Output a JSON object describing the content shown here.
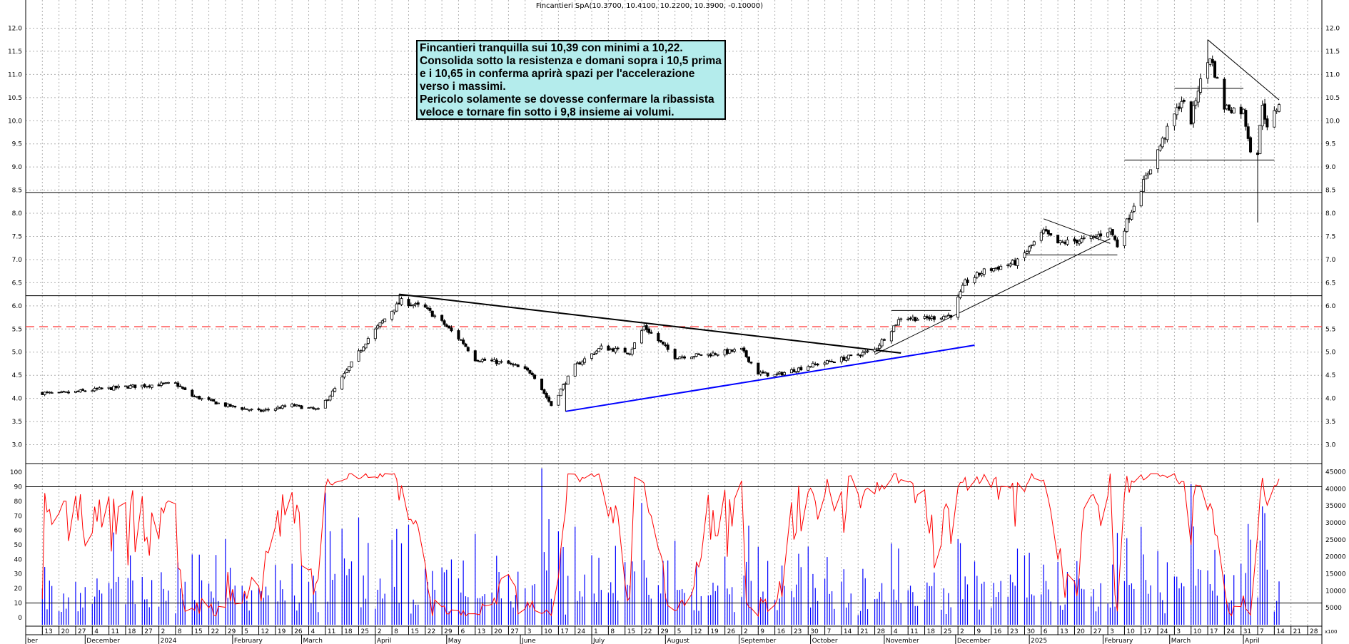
{
  "chart_data": [
    {
      "type": "candlestick",
      "title": "Fincantieri SpA(10.3700, 10.4100, 10.2200, 10.3900, -0.10000)",
      "ylim": [
        2.7,
        12.3
      ],
      "y_ticks": [
        "12.0",
        "11.5",
        "11.0",
        "10.5",
        "10.0",
        "9.5",
        "9.0",
        "8.5",
        "8.0",
        "7.5",
        "7.0",
        "6.5",
        "6.0",
        "5.5",
        "5.0",
        "4.5",
        "4.0",
        "3.5",
        "3.0"
      ],
      "annotation": "Fincantieri tranquilla sui 10,39 con minimi a 10,22.\nConsolida sotto la resistenza e domani sopra i 10,5 prima e i 10,65 in conferma aprirà spazi per l'accelerazione verso i massimi.\nPericolo solamente se dovesse confermare la ribassista veloce e tornare fin sotto i 9,8 insieme ai volumi.",
      "horizontal_levels": [
        8.45,
        6.22,
        5.55
      ],
      "dashed_level": 5.55,
      "anchors": [
        {
          "date": "2023-11-13",
          "close": 4.12
        },
        {
          "date": "2023-11-20",
          "close": 4.1
        },
        {
          "date": "2023-12-04",
          "close": 4.18
        },
        {
          "date": "2023-12-18",
          "close": 4.25
        },
        {
          "date": "2024-01-01",
          "close": 4.3
        },
        {
          "date": "2024-01-08",
          "close": 4.32
        },
        {
          "date": "2024-01-15",
          "close": 4.05
        },
        {
          "date": "2024-01-29",
          "close": 3.85
        },
        {
          "date": "2024-02-12",
          "close": 3.72
        },
        {
          "date": "2024-02-26",
          "close": 3.85
        },
        {
          "date": "2024-03-08",
          "close": 3.75
        },
        {
          "date": "2024-03-15",
          "close": 4.2
        },
        {
          "date": "2024-03-29",
          "close": 5.3
        },
        {
          "date": "2024-04-08",
          "close": 5.9
        },
        {
          "date": "2024-04-12",
          "close": 6.1
        },
        {
          "date": "2024-04-22",
          "close": 5.95
        },
        {
          "date": "2024-04-30",
          "close": 5.6
        },
        {
          "date": "2024-05-08",
          "close": 5.2
        },
        {
          "date": "2024-05-13",
          "close": 4.85
        },
        {
          "date": "2024-05-27",
          "close": 4.75
        },
        {
          "date": "2024-06-06",
          "close": 4.55
        },
        {
          "date": "2024-06-14",
          "close": 3.85
        },
        {
          "date": "2024-06-24",
          "close": 4.7
        },
        {
          "date": "2024-07-05",
          "close": 5.1
        },
        {
          "date": "2024-07-17",
          "close": 5.0
        },
        {
          "date": "2024-07-23",
          "close": 5.55
        },
        {
          "date": "2024-08-05",
          "close": 4.9
        },
        {
          "date": "2024-08-19",
          "close": 4.95
        },
        {
          "date": "2024-09-02",
          "close": 5.05
        },
        {
          "date": "2024-09-09",
          "close": 4.55
        },
        {
          "date": "2024-09-16",
          "close": 4.5
        },
        {
          "date": "2024-09-30",
          "close": 4.7
        },
        {
          "date": "2024-10-14",
          "close": 4.85
        },
        {
          "date": "2024-10-28",
          "close": 5.05
        },
        {
          "date": "2024-11-08",
          "close": 5.75
        },
        {
          "date": "2024-11-18",
          "close": 5.72
        },
        {
          "date": "2024-11-29",
          "close": 5.8
        },
        {
          "date": "2024-12-05",
          "close": 6.5
        },
        {
          "date": "2024-12-13",
          "close": 6.75
        },
        {
          "date": "2024-12-27",
          "close": 6.95
        },
        {
          "date": "2025-01-07",
          "close": 7.6
        },
        {
          "date": "2025-01-13",
          "close": 7.35
        },
        {
          "date": "2025-01-27",
          "close": 7.45
        },
        {
          "date": "2025-02-04",
          "close": 7.65
        },
        {
          "date": "2025-02-07",
          "close": 7.3
        },
        {
          "date": "2025-02-14",
          "close": 8.2
        },
        {
          "date": "2025-02-24",
          "close": 9.35
        },
        {
          "date": "2025-03-06",
          "close": 10.45
        },
        {
          "date": "2025-03-10",
          "close": 10.0
        },
        {
          "date": "2025-03-13",
          "close": 10.7
        },
        {
          "date": "2025-03-18",
          "close": 11.4
        },
        {
          "date": "2025-03-24",
          "close": 10.3
        },
        {
          "date": "2025-04-01",
          "close": 10.2
        },
        {
          "date": "2025-04-04",
          "close": 9.4
        },
        {
          "date": "2025-04-07",
          "close": 9.3
        },
        {
          "date": "2025-04-09",
          "close": 10.4
        },
        {
          "date": "2025-04-11",
          "close": 9.8
        },
        {
          "date": "2025-04-16",
          "close": 10.39
        }
      ],
      "extremes": [
        {
          "date": "2024-04-11",
          "high": 6.25
        },
        {
          "date": "2024-06-20",
          "low": 3.72
        },
        {
          "date": "2025-03-17",
          "high": 11.75
        },
        {
          "date": "2025-04-07",
          "low": 7.8
        }
      ],
      "trendlines": [
        {
          "color": "#000000",
          "width": 2,
          "from": {
            "date": "2024-04-11",
            "price": 6.25
          },
          "to": {
            "date": "2024-11-08",
            "price": 4.98
          }
        },
        {
          "color": "#0000ff",
          "width": 2,
          "from": {
            "date": "2024-06-20",
            "price": 3.72
          },
          "to": {
            "date": "2024-12-09",
            "price": 5.15
          }
        },
        {
          "color": "#000000",
          "width": 1,
          "from": {
            "date": "2024-10-28",
            "price": 4.95
          },
          "to": {
            "date": "2025-02-04",
            "price": 7.45
          }
        },
        {
          "color": "#000000",
          "width": 1,
          "from": {
            "date": "2025-01-07",
            "price": 7.88
          },
          "to": {
            "date": "2025-02-04",
            "price": 7.35
          }
        },
        {
          "color": "#000000",
          "width": 1,
          "from": {
            "date": "2025-03-17",
            "price": 11.75
          },
          "to": {
            "date": "2025-04-16",
            "price": 10.45
          }
        },
        {
          "color": "#000000",
          "width": 1,
          "from": {
            "date": "2024-11-04",
            "price": 5.9
          },
          "to": {
            "date": "2024-11-29",
            "price": 5.9
          }
        },
        {
          "color": "#000000",
          "width": 1,
          "from": {
            "date": "2024-12-30",
            "price": 7.1
          },
          "to": {
            "date": "2025-02-07",
            "price": 7.1
          }
        },
        {
          "color": "#000000",
          "width": 1,
          "from": {
            "date": "2025-02-10",
            "price": 9.15
          },
          "to": {
            "date": "2025-04-14",
            "price": 9.15
          }
        },
        {
          "color": "#000000",
          "width": 1,
          "from": {
            "date": "2025-03-03",
            "price": 10.7
          },
          "to": {
            "date": "2025-04-01",
            "price": 10.7
          }
        }
      ]
    },
    {
      "type": "line+bar",
      "left_ylim": [
        -5,
        105
      ],
      "left_ticks": [
        "100",
        "90",
        "80",
        "70",
        "60",
        "50",
        "40",
        "30",
        "20",
        "10",
        "0"
      ],
      "right_ylim": [
        0,
        47000
      ],
      "right_ticks": [
        "45000",
        "40000",
        "35000",
        "30000",
        "25000",
        "20000",
        "15000",
        "10000",
        "5000"
      ],
      "levels": [
        90,
        10
      ],
      "oscillator_color": "#ff0000",
      "volume_color": "#0000ff",
      "x_days": [
        "13",
        "20",
        "27",
        "4",
        "11",
        "18",
        "27",
        "2",
        "8",
        "15",
        "22",
        "29",
        "5",
        "12",
        "19",
        "26",
        "4",
        "11",
        "18",
        "25",
        "2",
        "8",
        "15",
        "22",
        "29",
        "6",
        "13",
        "20",
        "27",
        "3",
        "10",
        "17",
        "24",
        "1",
        "8",
        "15",
        "22",
        "29",
        "5",
        "12",
        "19",
        "26",
        "2",
        "9",
        "16",
        "23",
        "30",
        "7",
        "14",
        "21",
        "28",
        "4",
        "11",
        "18",
        "25",
        "2",
        "9",
        "16",
        "23",
        "30",
        "6",
        "13",
        "20",
        "27",
        "3",
        "10",
        "17",
        "24",
        "3",
        "10",
        "17",
        "24",
        "31",
        "7",
        "14",
        "21",
        "28"
      ],
      "x_months": [
        "ber",
        "December",
        "2024",
        "February",
        "March",
        "April",
        "May",
        "June",
        "July",
        "August",
        "September",
        "October",
        "November",
        "December",
        "2025",
        "February",
        "March",
        "April"
      ],
      "volume_scale_label": "x100"
    }
  ]
}
